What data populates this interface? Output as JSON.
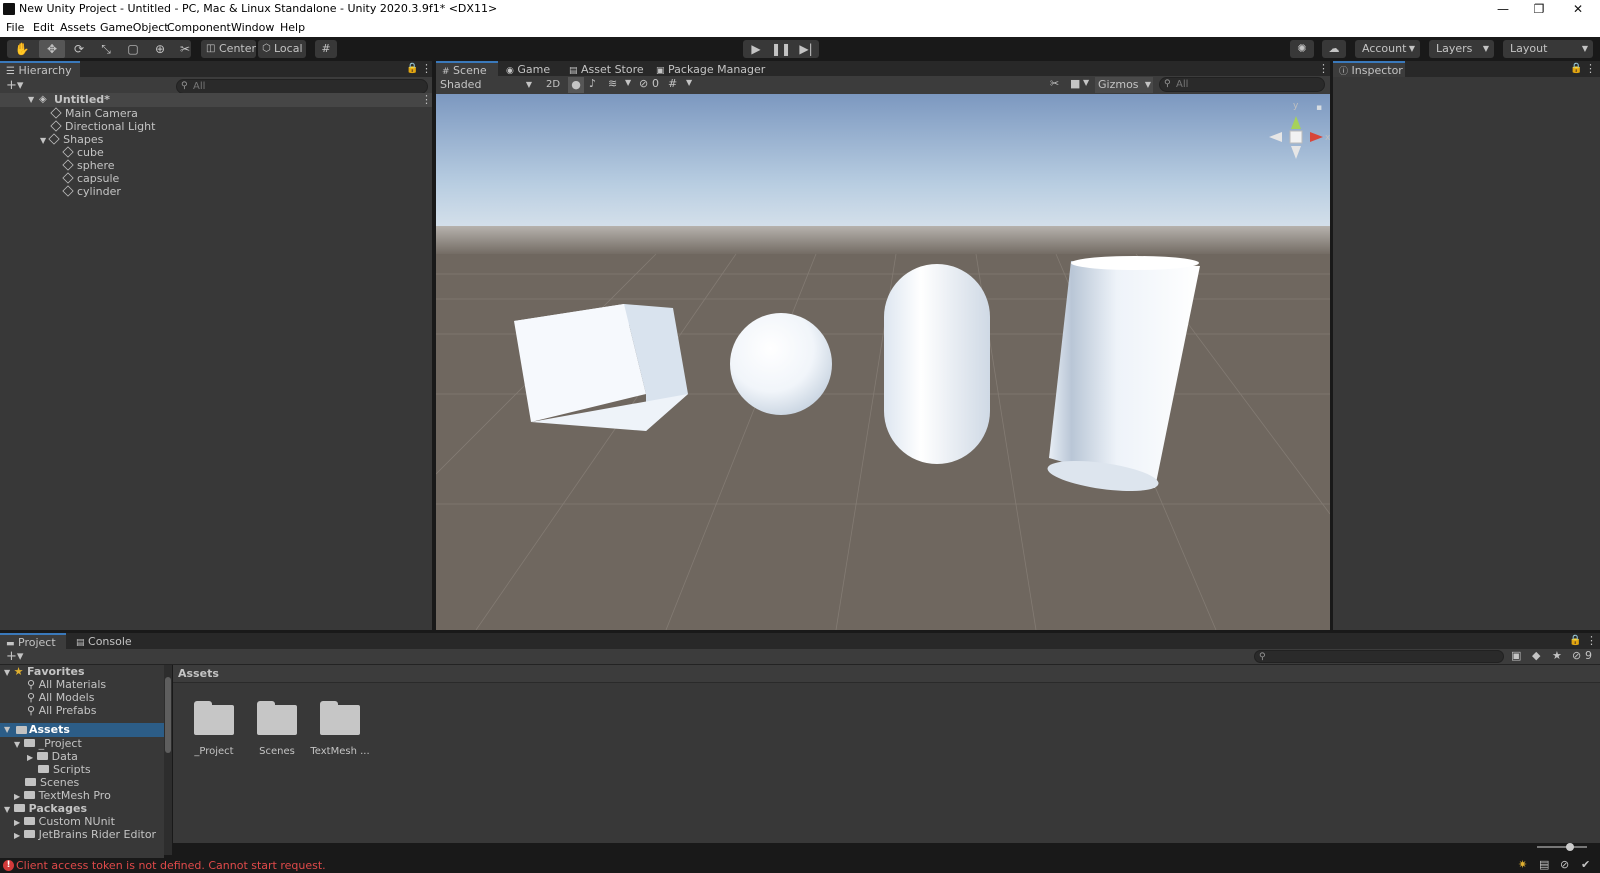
{
  "window": {
    "title": "New Unity Project - Untitled - PC, Mac & Linux Standalone - Unity 2020.3.9f1* <DX11>",
    "minimize": "—",
    "maximize": "❐",
    "close": "✕"
  },
  "menu": [
    "File",
    "Edit",
    "Assets",
    "GameObject",
    "Component",
    "Window",
    "Help"
  ],
  "toolbar": {
    "pivot_label": "Center",
    "space_label": "Local",
    "account_label": "Account",
    "layers_label": "Layers",
    "layout_label": "Layout"
  },
  "hierarchy": {
    "tab": "Hierarchy",
    "search_placeholder": "All",
    "scene": "Untitled*",
    "items": [
      "Main Camera",
      "Directional Light",
      "Shapes",
      "cube",
      "sphere",
      "capsule",
      "cylinder"
    ]
  },
  "scene_tabs": [
    "Scene",
    "Game",
    "Asset Store",
    "Package Manager"
  ],
  "scene_bar": {
    "shading": "Shaded",
    "mode_2d": "2D",
    "hidden_count": "0",
    "gizmos": "Gizmos",
    "search_placeholder": "All"
  },
  "gizmo_axes": {
    "y": "y",
    "x": "x"
  },
  "inspector": {
    "tab": "Inspector"
  },
  "project": {
    "tabs": [
      "Project",
      "Console"
    ],
    "breadcrumb": "Assets",
    "hidden_packages_count": "9",
    "favorites": {
      "label": "Favorites",
      "items": [
        "All Materials",
        "All Models",
        "All Prefabs"
      ]
    },
    "tree": {
      "assets": "Assets",
      "project_folder": "_Project",
      "data": "Data",
      "scripts": "Scripts",
      "scenes": "Scenes",
      "textmesh": "TextMesh Pro",
      "packages": "Packages",
      "custom_nunit": "Custom NUnit",
      "rider": "JetBrains Rider Editor"
    },
    "assets": [
      "_Project",
      "Scenes",
      "TextMesh ..."
    ]
  },
  "status": {
    "error": "Client access token is not defined. Cannot start request."
  },
  "colors": {
    "accent": "#3a79bb",
    "error": "#e04a4a",
    "panel": "#383838",
    "background": "#191919"
  }
}
